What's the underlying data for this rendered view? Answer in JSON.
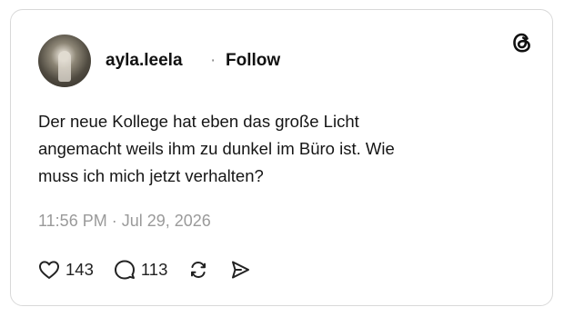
{
  "post": {
    "username": "ayla.leela",
    "separator": "·",
    "follow_label": "Follow",
    "text_lines": [
      "Der neue Kollege hat eben das große Licht",
      "angemacht weils ihm zu dunkel im Büro ist. Wie",
      "muss ich mich jetzt verhalten?"
    ],
    "timestamp": "11:56 PM · Jul 29, 2026",
    "likes": "143",
    "replies": "113"
  },
  "icons": {
    "brand": "threads-logo-icon",
    "like": "heart-icon",
    "reply": "speech-bubble-icon",
    "repost": "repost-icon",
    "share": "send-icon"
  }
}
